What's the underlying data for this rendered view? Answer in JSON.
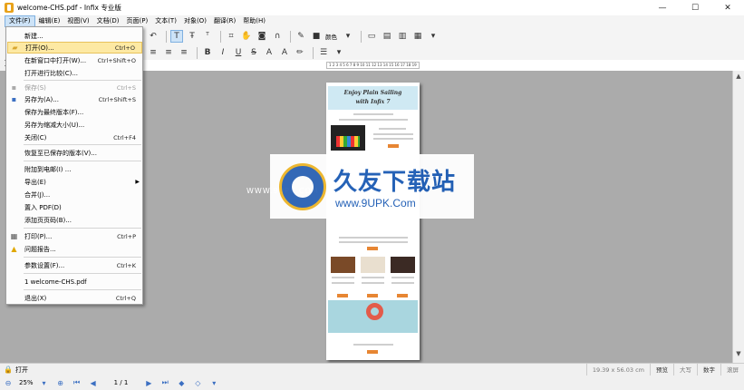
{
  "window": {
    "title": "welcome-CHS.pdf - Infix 专业版",
    "minimize": "—",
    "maximize": "☐",
    "close": "✕"
  },
  "menubar": [
    "文件(F)",
    "编辑(E)",
    "视图(V)",
    "文档(D)",
    "页面(P)",
    "文本(T)",
    "对象(O)",
    "翻译(R)",
    "帮助(H)"
  ],
  "toolbar": {
    "color_label": "颜色"
  },
  "ruler_text": "1 2 3 4 5 6 7 8 9 10 11 12 13 14 15 16 17 18 19",
  "file_menu": {
    "items": [
      {
        "label": "新建...",
        "shortcut": "",
        "icon": ""
      },
      {
        "label": "打开(O)...",
        "shortcut": "Ctrl+O",
        "icon": "folder-icon",
        "highlight": true
      },
      {
        "label": "在新窗口中打开(W)...",
        "shortcut": "Ctrl+Shift+O",
        "icon": ""
      },
      {
        "label": "打开进行比较(C)...",
        "shortcut": "",
        "icon": ""
      },
      {
        "label": "保存(S)",
        "shortcut": "Ctrl+S",
        "icon": "save-icon",
        "disabled": true
      },
      {
        "label": "另存为(A)...",
        "shortcut": "Ctrl+Shift+S",
        "icon": "save-as-icon"
      },
      {
        "label": "保存为最终版本(F)...",
        "shortcut": "",
        "icon": ""
      },
      {
        "label": "另存为缩减大小(U)...",
        "shortcut": "",
        "icon": ""
      },
      {
        "label": "关闭(C)",
        "shortcut": "Ctrl+F4",
        "icon": ""
      },
      {
        "label": "恢复至已保存的版本(V)...",
        "shortcut": "",
        "icon": ""
      },
      {
        "label": "附加到电邮(I) ...",
        "shortcut": "",
        "icon": ""
      },
      {
        "label": "导出(E)",
        "shortcut": "",
        "icon": "",
        "submenu": true
      },
      {
        "label": "合并(J)...",
        "shortcut": "",
        "icon": ""
      },
      {
        "label": "置入 PDF(D)",
        "shortcut": "",
        "icon": ""
      },
      {
        "label": "添加页页码(B)...",
        "shortcut": "",
        "icon": ""
      },
      {
        "label": "打印(P)...",
        "shortcut": "Ctrl+P",
        "icon": "printer-icon"
      },
      {
        "label": "问题报告...",
        "shortcut": "",
        "icon": "warning-icon"
      },
      {
        "label": "参数设置(F)...",
        "shortcut": "Ctrl+K",
        "icon": ""
      },
      {
        "label": "1 welcome-CHS.pdf",
        "shortcut": "",
        "icon": ""
      },
      {
        "label": "退出(X)",
        "shortcut": "Ctrl+Q",
        "icon": ""
      }
    ]
  },
  "document_page": {
    "banner_line1": "Enjoy Plain Sailing",
    "banner_line2": "with Infix 7"
  },
  "watermark": {
    "title": "久友下载站",
    "url": "www.9UPK.Com",
    "side": "WWW.9UPK.COM"
  },
  "status": {
    "text": "打开",
    "dimensions": "19.39 x 56.03 cm",
    "mode": "预览",
    "caps": "大写",
    "num": "数字",
    "scroll": "滚屏"
  },
  "nav": {
    "zoom": "25%",
    "page": "1 / 1"
  },
  "colors": {
    "accent_highlight": "#fde9a3",
    "menubar_active": "#cde3f7",
    "workspace": "#ababab",
    "brand_blue": "#1d5cb5"
  }
}
